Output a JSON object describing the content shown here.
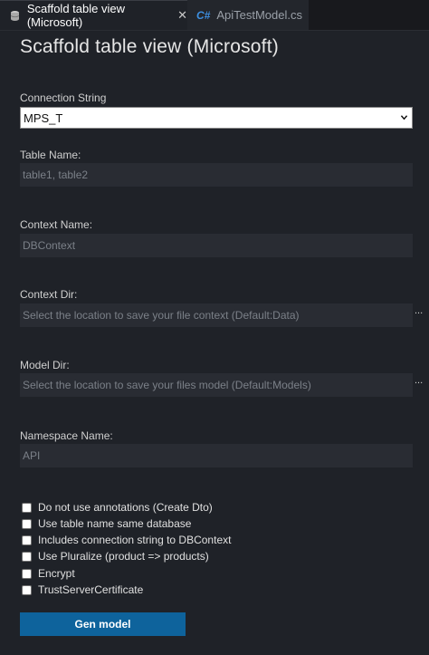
{
  "tabs": [
    {
      "label": "Scaffold table view (Microsoft)",
      "close": "✕"
    },
    {
      "label": "ApiTestModel.cs",
      "prefix": "C#"
    }
  ],
  "title": "Scaffold table view (Microsoft)",
  "connection": {
    "label": "Connection String",
    "value": "MPS_T"
  },
  "table_name": {
    "label": "Table Name:",
    "placeholder": "table1, table2"
  },
  "context_name": {
    "label": "Context Name:",
    "placeholder": "DBContext"
  },
  "context_dir": {
    "label": "Context Dir:",
    "placeholder": "Select the location to save your file context (Default:Data)",
    "browse": "..."
  },
  "model_dir": {
    "label": "Model Dir:",
    "placeholder": "Select the location to save your files model (Default:Models)",
    "browse": "..."
  },
  "namespace": {
    "label": "Namespace Name:",
    "placeholder": "API"
  },
  "options": [
    {
      "label": "Do not use annotations (Create Dto)",
      "checked": false
    },
    {
      "label": "Use table name same database",
      "checked": false
    },
    {
      "label": "Includes connection string to DBContext",
      "checked": false
    },
    {
      "label": "Use Pluralize (product => products)",
      "checked": false
    },
    {
      "label": "Encrypt",
      "checked": false
    },
    {
      "label": "TrustServerCertificate",
      "checked": false
    }
  ],
  "gen_button": "Gen model"
}
